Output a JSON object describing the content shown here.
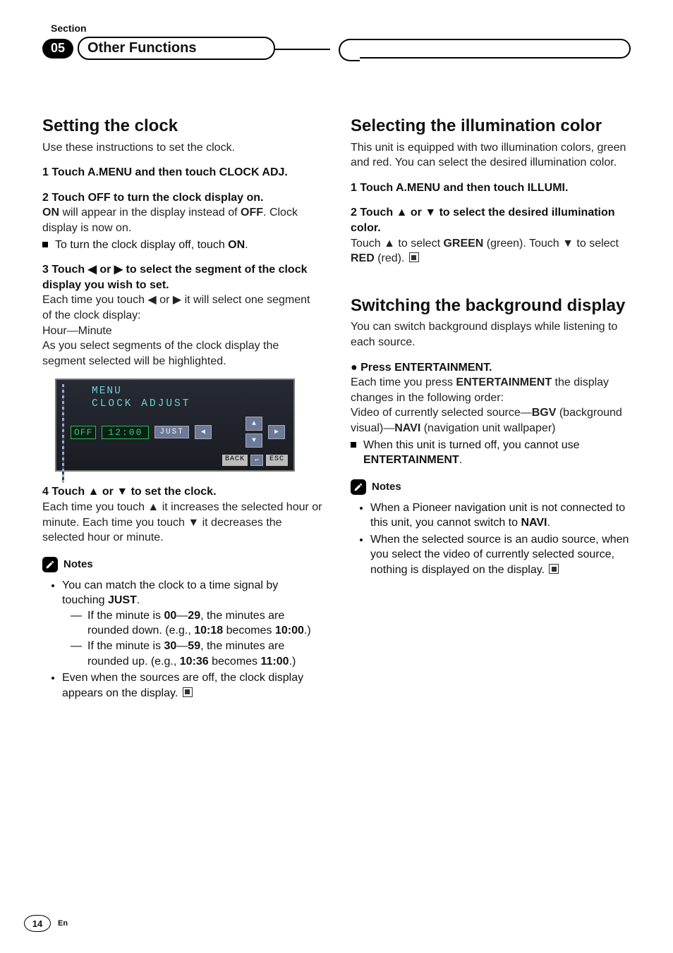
{
  "header": {
    "section_label": "Section",
    "section_number": "05",
    "title": "Other Functions"
  },
  "left": {
    "h_clock": "Setting the clock",
    "intro": "Use these instructions to set the clock.",
    "step1_lead": "1    Touch A.MENU and then touch CLOCK ADJ.",
    "step2_lead": "2    Touch OFF to turn the clock display on.",
    "step2_body_a": "ON",
    "step2_body_b": " will appear in the display instead of ",
    "step2_body_c": "OFF",
    "step2_body_d": ". Clock display is now on.",
    "step2_bullet": "To turn the clock display off, touch ",
    "step2_bullet_b": "ON",
    "step2_bullet_c": ".",
    "step3_lead": "3    Touch ◀ or ▶ to select the segment of the clock display you wish to set.",
    "step3_body_a": "Each time you touch ◀ or ▶ it will select one segment of the clock display:",
    "step3_body_b": "Hour—Minute",
    "step3_body_c": "As you select segments of the clock display the segment selected will be highlighted.",
    "figure": {
      "menu": "MENU",
      "clock_adjust": "CLOCK ADJUST",
      "off": "OFF",
      "time": "12:00",
      "just": "JUST",
      "back": "BACK",
      "esc": "ESC"
    },
    "step4_lead": "4    Touch ▲ or ▼ to set the clock.",
    "step4_body": "Each time you touch ▲ it increases the selected hour or minute. Each time you touch ▼ it decreases the selected hour or minute.",
    "notes_title": "Notes",
    "note1_a": "You can match the clock to a time signal by touching ",
    "note1_b": "JUST",
    "note1_c": ".",
    "note1_d1_a": "If the minute is ",
    "note1_d1_b": "00",
    "note1_d1_c": "—",
    "note1_d1_d": "29",
    "note1_d1_e": ", the minutes are rounded down. (e.g., ",
    "note1_d1_f": "10:18",
    "note1_d1_g": " becomes ",
    "note1_d1_h": "10:00",
    "note1_d1_i": ".)",
    "note1_d2_a": "If the minute is ",
    "note1_d2_b": "30",
    "note1_d2_c": "—",
    "note1_d2_d": "59",
    "note1_d2_e": ", the minutes are rounded up. (e.g., ",
    "note1_d2_f": "10:36",
    "note1_d2_g": " becomes ",
    "note1_d2_h": "11:00",
    "note1_d2_i": ".)",
    "note2": "Even when the sources are off, the clock display appears on the display."
  },
  "right": {
    "h_illum": "Selecting the illumination color",
    "illum_intro": "This unit is equipped with two illumination colors, green and red. You can select the desired illumination color.",
    "illum_step1": "1    Touch A.MENU and then touch ILLUMI.",
    "illum_step2_lead": "2    Touch ▲ or ▼ to select the desired illumination color.",
    "illum_step2_body_a": "Touch ▲ to select ",
    "illum_step2_body_b": "GREEN",
    "illum_step2_body_c": " (green). Touch ▼ to select ",
    "illum_step2_body_d": "RED",
    "illum_step2_body_e": " (red).",
    "h_bg": "Switching the background display",
    "bg_intro": "You can switch background displays while listening to each source.",
    "bg_step_lead": "●    Press ENTERTAINMENT.",
    "bg_step_body_a": "Each time you press ",
    "bg_step_body_b": "ENTERTAINMENT",
    "bg_step_body_c": " the display changes in the following order:",
    "bg_order_a": "Video of currently selected source—",
    "bg_order_b": "BGV",
    "bg_order_c": " (background visual)—",
    "bg_order_d": "NAVI",
    "bg_order_e": " (navigation unit wallpaper)",
    "bg_bullet_a": "When this unit is turned off, you cannot use ",
    "bg_bullet_b": "ENTERTAINMENT",
    "bg_bullet_c": ".",
    "notes_title": "Notes",
    "bg_note1_a": "When a Pioneer navigation unit is not connected to this unit, you cannot switch to ",
    "bg_note1_b": "NAVI",
    "bg_note1_c": ".",
    "bg_note2": "When the selected source is an audio source, when you select the video of currently selected source, nothing is displayed on the display."
  },
  "footer": {
    "page": "14",
    "lang": "En"
  }
}
